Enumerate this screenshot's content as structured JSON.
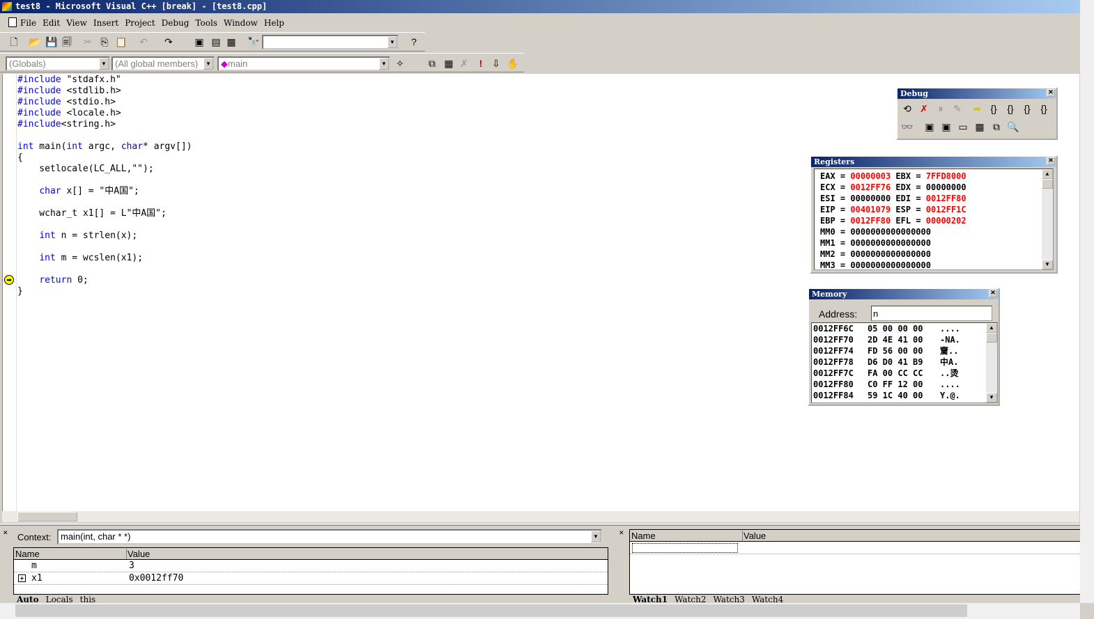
{
  "window": {
    "title": "test8 - Microsoft Visual C++ [break] - [test8.cpp]"
  },
  "menu": [
    "File",
    "Edit",
    "View",
    "Insert",
    "Project",
    "Debug",
    "Tools",
    "Window",
    "Help"
  ],
  "toolbar": {
    "find_value": "",
    "scope_combo": "(Globals)",
    "members_combo": "(All global members)",
    "function_combo": "main"
  },
  "editor": {
    "lines": [
      [
        {
          "t": "#include",
          "k": 1
        },
        {
          "t": " \"stdafx.h\""
        }
      ],
      [
        {
          "t": "#include",
          "k": 1
        },
        {
          "t": " <stdlib.h>"
        }
      ],
      [
        {
          "t": "#include",
          "k": 1
        },
        {
          "t": " <stdio.h>"
        }
      ],
      [
        {
          "t": "#include",
          "k": 1
        },
        {
          "t": " <locale.h>"
        }
      ],
      [
        {
          "t": "#include",
          "k": 1
        },
        {
          "t": "<string.h>"
        }
      ],
      [],
      [
        {
          "t": "int",
          "k": 1
        },
        {
          "t": " main("
        },
        {
          "t": "int",
          "k": 1
        },
        {
          "t": " argc, "
        },
        {
          "t": "char",
          "k": 1
        },
        {
          "t": "* argv[])"
        }
      ],
      [
        {
          "t": "{"
        }
      ],
      [
        {
          "t": "    setlocale(LC_ALL,\"\");"
        }
      ],
      [],
      [
        {
          "t": "    "
        },
        {
          "t": "char",
          "k": 1
        },
        {
          "t": " x[] = \"中A国\";"
        }
      ],
      [],
      [
        {
          "t": "    wchar_t x1[] = L\"中A国\";"
        }
      ],
      [],
      [
        {
          "t": "    "
        },
        {
          "t": "int",
          "k": 1
        },
        {
          "t": " n = strlen(x);"
        }
      ],
      [],
      [
        {
          "t": "    "
        },
        {
          "t": "int",
          "k": 1
        },
        {
          "t": " m = wcslen(x1);"
        }
      ],
      [],
      [
        {
          "t": "    "
        },
        {
          "t": "return",
          "k": 1
        },
        {
          "t": " 0;"
        }
      ],
      [
        {
          "t": "}"
        }
      ]
    ],
    "current_line": 19
  },
  "debug_toolbar": {
    "title": "Debug"
  },
  "registers": {
    "title": "Registers",
    "rows": [
      [
        {
          "n": "EAX",
          "v": "00000003",
          "c": 1
        },
        {
          "n": "EBX",
          "v": "7FFD8000",
          "c": 1
        }
      ],
      [
        {
          "n": "ECX",
          "v": "0012FF76",
          "c": 1
        },
        {
          "n": "EDX",
          "v": "00000000",
          "c": 0
        }
      ],
      [
        {
          "n": "ESI",
          "v": "00000000",
          "c": 0
        },
        {
          "n": "EDI",
          "v": "0012FF80",
          "c": 1
        }
      ],
      [
        {
          "n": "EIP",
          "v": "00401079",
          "c": 1
        },
        {
          "n": "ESP",
          "v": "0012FF1C",
          "c": 1
        }
      ],
      [
        {
          "n": "EBP",
          "v": "0012FF80",
          "c": 1
        },
        {
          "n": "EFL",
          "v": "00000202",
          "c": 1
        }
      ],
      [
        {
          "n": "MM0",
          "v": "0000000000000000",
          "c": 0
        }
      ],
      [
        {
          "n": "MM1",
          "v": "0000000000000000",
          "c": 0
        }
      ],
      [
        {
          "n": "MM2",
          "v": "0000000000000000",
          "c": 0
        }
      ],
      [
        {
          "n": "MM3",
          "v": "0000000000000000",
          "c": 0
        }
      ]
    ],
    "changed_color": "#ff0000"
  },
  "memory": {
    "title": "Memory",
    "address_label": "Address:",
    "address_value": "n",
    "rows": [
      {
        "addr": "0012FF6C",
        "bytes": "05 00 00 00",
        "ascii": "...."
      },
      {
        "addr": "0012FF70",
        "bytes": "2D 4E 41 00",
        "ascii": "-NA."
      },
      {
        "addr": "0012FF74",
        "bytes": "FD 56 00 00",
        "ascii": "齎.."
      },
      {
        "addr": "0012FF78",
        "bytes": "D6 D0 41 B9",
        "ascii": "中A."
      },
      {
        "addr": "0012FF7C",
        "bytes": "FA 00 CC CC",
        "ascii": "..烫"
      },
      {
        "addr": "0012FF80",
        "bytes": "C0 FF 12 00",
        "ascii": "...."
      },
      {
        "addr": "0012FF84",
        "bytes": "59 1C 40 00",
        "ascii": "Y.@."
      }
    ]
  },
  "variables": {
    "context_label": "Context:",
    "context_value": "main(int, char * *)",
    "col_name": "Name",
    "col_value": "Value",
    "rows": [
      {
        "name": "m",
        "value": "3",
        "expand": ""
      },
      {
        "name": "x1",
        "value": "0x0012ff70",
        "expand": "+"
      }
    ],
    "tabs": [
      "Auto",
      "Locals",
      "this"
    ]
  },
  "watch": {
    "col_name": "Name",
    "col_value": "Value",
    "tabs": [
      "Watch1",
      "Watch2",
      "Watch3",
      "Watch4"
    ]
  }
}
